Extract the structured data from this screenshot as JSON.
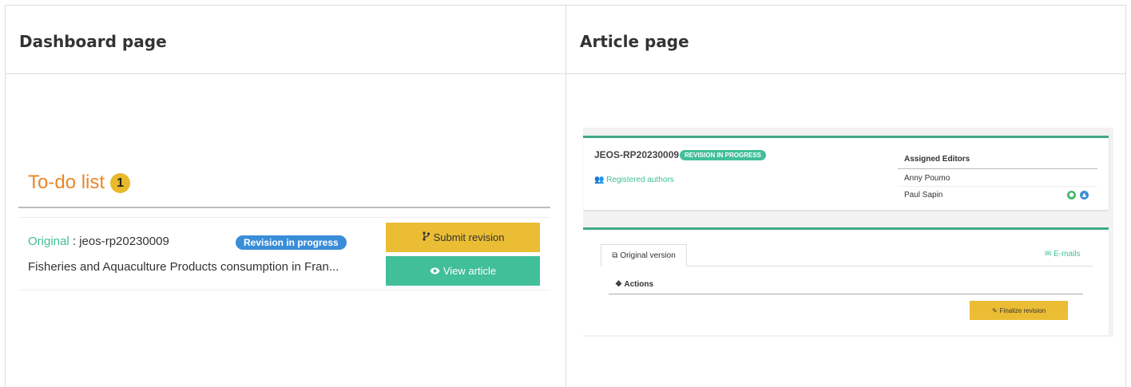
{
  "columns": {
    "left_title": "Dashboard page",
    "right_title": "Article page"
  },
  "dashboard": {
    "todo_title": "To-do list",
    "todo_count": "1",
    "item": {
      "link_label": "Original",
      "separator": " : ",
      "article_id": "jeos-rp20230009",
      "status": "Revision in progress",
      "title": "Fisheries and Aquaculture Products consumption in Fran..."
    },
    "buttons": {
      "submit_revision": "Submit revision",
      "view_article": "View article"
    },
    "colors": {
      "todo_title": "#e8862a",
      "badge": "#e9b92c",
      "status": "#3a8ed8",
      "submit": "#ebbd34",
      "view": "#41bf98"
    }
  },
  "article": {
    "id": "JEOS-RP20230009",
    "status_badge": "REVISION IN PROGRESS",
    "registered_authors": "Registered authors",
    "assigned_editors_title": "Assigned Editors",
    "editors": [
      "Anny Poumo",
      "Paul Sapin"
    ],
    "tab_original_version": "Original version",
    "emails_link": "E-mails",
    "actions_title": "Actions",
    "finalize_button": "Finalize revision",
    "icons": [
      "users-icon",
      "copy-icon",
      "envelope-icon",
      "info-circle-icon",
      "pencil-icon",
      "tag-icon",
      "pin-icon"
    ],
    "colors": {
      "accent": "#41bf98",
      "border": "#41a98a",
      "finalize": "#ebbd34"
    }
  }
}
